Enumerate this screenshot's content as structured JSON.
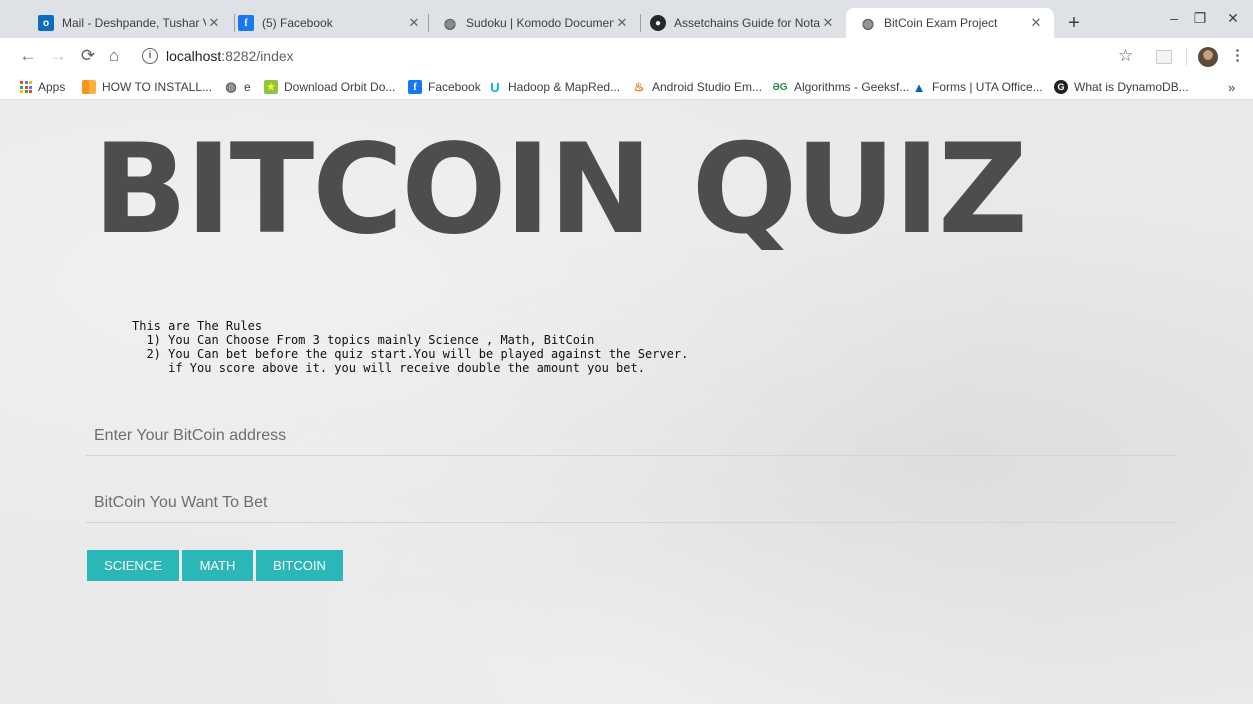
{
  "browser": {
    "tabs": [
      {
        "title": "Mail - Deshpande, Tushar Vish",
        "icon": "outlook-icon",
        "active": false
      },
      {
        "title": "(5) Facebook",
        "icon": "facebook-icon",
        "active": false
      },
      {
        "title": "Sudoku | Komodo Documentat",
        "icon": "globe-icon",
        "active": false
      },
      {
        "title": "Assetchains Guide for Notary N",
        "icon": "github-icon",
        "active": false
      },
      {
        "title": "BitCoin Exam Project",
        "icon": "globe-icon",
        "active": true
      }
    ],
    "new_tab": "+",
    "window_controls": {
      "minimize": "–",
      "restore": "❐",
      "close": "✕"
    },
    "url_host": "localhost",
    "url_path": ":8282/index",
    "bookmarks": [
      {
        "label": "Apps",
        "icon": "apps-grid-icon"
      },
      {
        "label": "HOW TO INSTALL...",
        "icon": "bookmark-orange-icon"
      },
      {
        "label": "e",
        "icon": "globe-icon"
      },
      {
        "label": "Download Orbit Do...",
        "icon": "orbit-star-icon"
      },
      {
        "label": "Facebook",
        "icon": "facebook-icon"
      },
      {
        "label": "Hadoop & MapRed...",
        "icon": "udacity-icon"
      },
      {
        "label": "Android Studio Em...",
        "icon": "java-icon"
      },
      {
        "label": "Algorithms - Geeksf...",
        "icon": "geeksforgeeks-icon"
      },
      {
        "label": "Forms | UTA Office...",
        "icon": "uta-icon"
      },
      {
        "label": "What is DynamoDB...",
        "icon": "g-icon"
      }
    ],
    "overflow": "»"
  },
  "page": {
    "title": "BITCOIN QUIZ",
    "rules_heading": "This are The Rules",
    "rules": [
      "  1) You Can Choose From 3 topics mainly Science , Math, BitCoin",
      "  2) You Can bet before the quiz start.You will be played against the Server.",
      "     if You score above it. you will receive double the amount you bet."
    ],
    "address_placeholder": "Enter Your BitCoin address",
    "bet_placeholder": "BitCoin You Want To Bet",
    "buttons": {
      "science": "SCIENCE",
      "math": "MATH",
      "bitcoin": "BITCOIN"
    }
  },
  "colors": {
    "accent": "#2bb7b8",
    "title": "#4d4d4d",
    "page_bg": "#e9e9e9"
  }
}
